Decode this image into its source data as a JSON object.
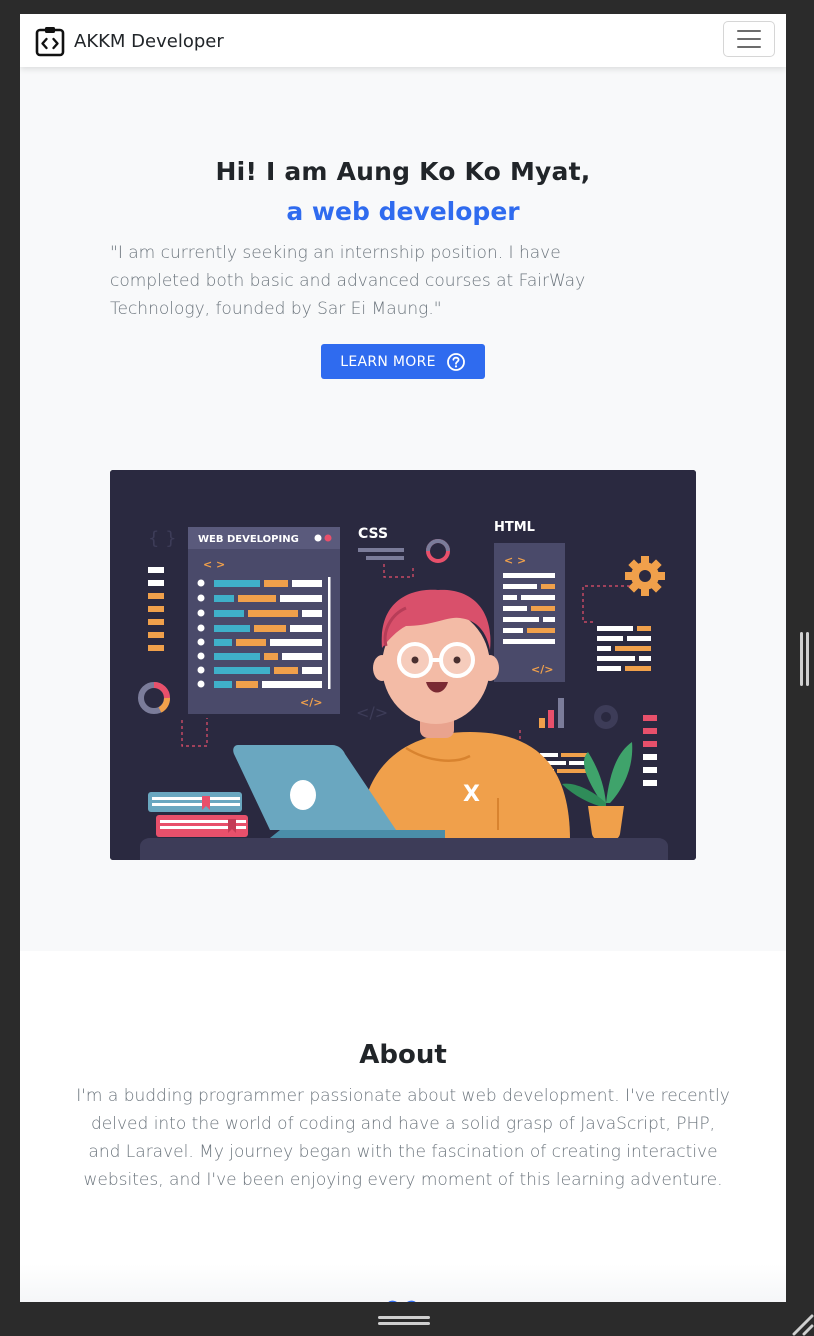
{
  "navbar": {
    "brand": "AKKM Developer",
    "brand_icon": "code-clipboard-icon",
    "toggler_icon": "hamburger-menu-icon"
  },
  "hero": {
    "title": "Hi! I am Aung Ko Ko Myat,",
    "subtitle": "a web developer",
    "quote": "\"I am currently seeking an internship position. I have completed both basic and advanced courses at FairWay Technology, founded by Sar Ei Maung.\"",
    "learn_more_label": "LEARN MORE",
    "learn_more_icon": "question-circle-icon",
    "illustration": {
      "panel_web_title": "WEB DEVELOPING",
      "tag_code_open": "< >",
      "tag_code_close": "</>",
      "css_label": "CSS",
      "html_label": "HTML",
      "brackets_text": "{ }",
      "shirt_letter": "X"
    }
  },
  "about": {
    "title": "About",
    "text": "I'm a budding programmer passionate about web development. I've recently delved into the world of coding and have a solid grasp of JavaScript, PHP, and Laravel. My journey began with the fascination of creating interactive websites, and I've been enjoying every moment of this learning adventure."
  },
  "colors": {
    "accent": "#2f6bef",
    "hero_bg": "#f8f9fa",
    "text_dark": "#212529",
    "text_muted": "#6c757d",
    "illustration_bg": "#2a2940"
  }
}
